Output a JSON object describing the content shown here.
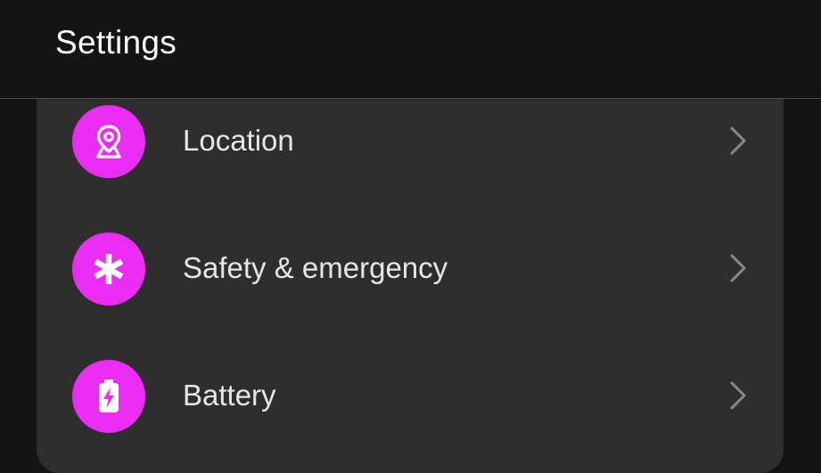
{
  "header": {
    "title": "Settings"
  },
  "settings_items": [
    {
      "label": "Location",
      "icon": "location-pin-icon"
    },
    {
      "label": "Safety & emergency",
      "icon": "asterisk-icon"
    },
    {
      "label": "Battery",
      "icon": "battery-charging-icon"
    }
  ],
  "colors": {
    "background": "#141414",
    "card": "#2e2e2e",
    "icon_accent": "#ea2cf4",
    "text": "#e6e6e6",
    "chevron": "#8a8a8a"
  }
}
